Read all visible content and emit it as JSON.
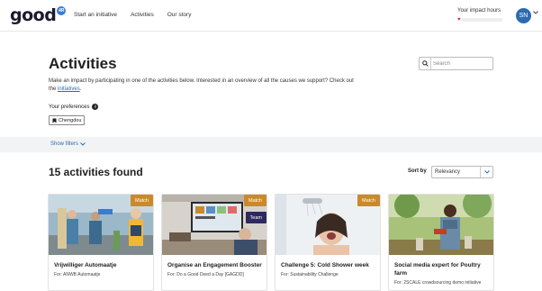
{
  "header": {
    "logo_text": "good",
    "logo_badge": "4R",
    "nav": [
      "Start an initiative",
      "Activities",
      "Our story"
    ],
    "impact_label": "Your impact hours",
    "avatar_initials": "SN"
  },
  "main": {
    "title": "Activities",
    "search_placeholder": "Search",
    "intro_text": "Make an impact by participating in one of the activities below. Interested in an overview of all the causes we support? Check out the ",
    "intro_link": "initiatives",
    "intro_end": ".",
    "preferences_title": "Your preferences",
    "preference_chip": "Chengdou",
    "show_filters": "Show filters",
    "count_title": "15 activities found",
    "sort_label": "Sort by",
    "sort_value": "Relevancy"
  },
  "cards": [
    {
      "title": "Vrijwilliger Automaatje",
      "for": "For: ANWB Automaatje",
      "badges": [
        "Match"
      ]
    },
    {
      "title": "Organise an Engagement Booster",
      "for": "For: Do a Good Deed a Day [GAGDD]",
      "badges": [
        "Match",
        "Team"
      ]
    },
    {
      "title": "Challenge 5: Cold Shower week",
      "for": "For: Sustainability Challenge",
      "badges": [
        "Match"
      ]
    },
    {
      "title": "Social media expert for Poultry farm",
      "for": "For: 2SCALE crowdsourcing demo initiative",
      "badges": []
    }
  ],
  "colors": {
    "accent_blue": "#2b6cb0",
    "match_badge": "#c98a2e",
    "team_badge": "#2d2a5e",
    "heart": "#e0245e"
  },
  "icons": [
    "search-icon",
    "info-icon",
    "bookmark-icon",
    "chevron-down-icon",
    "heart-icon"
  ]
}
